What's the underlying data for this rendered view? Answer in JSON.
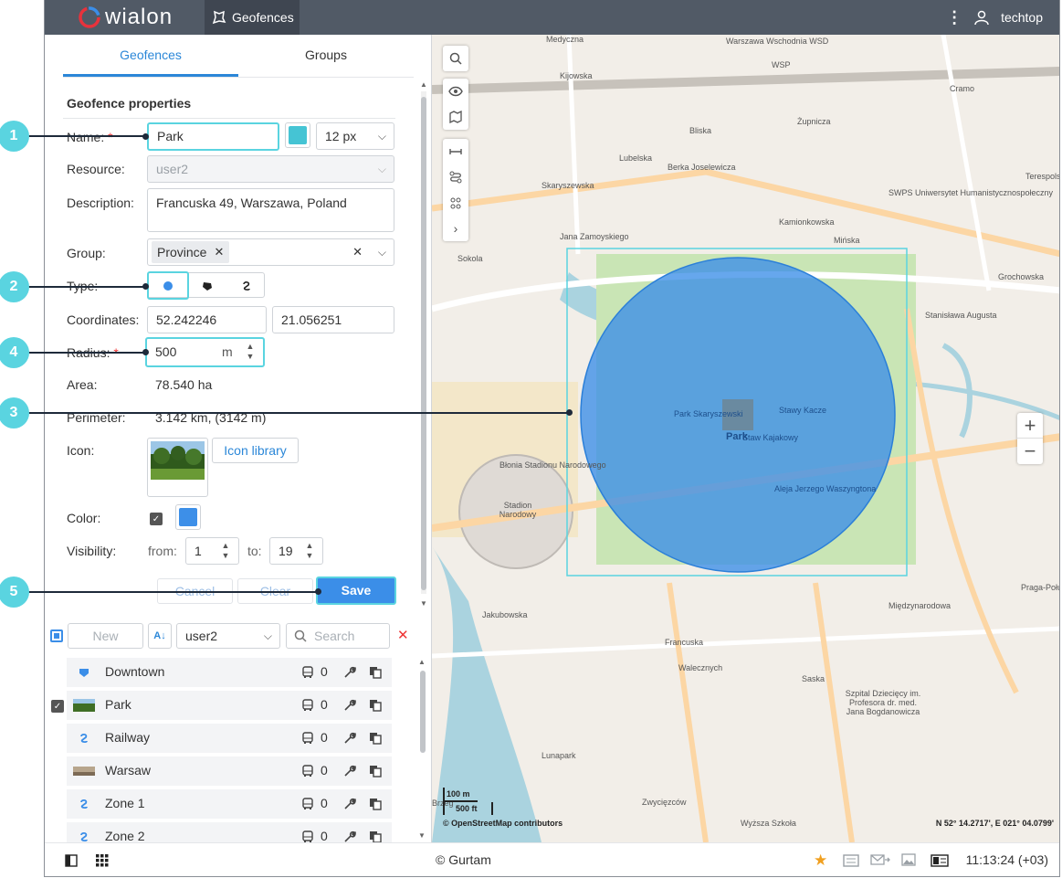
{
  "topbar": {
    "logo": "wialon",
    "app_title": "Geofences",
    "user": "techtop"
  },
  "tabs": [
    {
      "label": "Geofences",
      "active": true
    },
    {
      "label": "Groups",
      "active": false
    }
  ],
  "form": {
    "section_title": "Geofence properties",
    "name_label": "Name:",
    "required_mark": "*",
    "name_value": "Park",
    "name_color": "#45c4d4",
    "font_size": "12 px",
    "resource_label": "Resource:",
    "resource_value": "user2",
    "description_label": "Description:",
    "description_value": "Francuska 49, Warszawa, Poland",
    "group_label": "Group:",
    "group_tag": "Province",
    "type_label": "Type:",
    "coordinates_label": "Coordinates:",
    "lat": "52.242246",
    "lon": "21.056251",
    "radius_label": "Radius:",
    "radius_value": "500",
    "radius_unit": "m",
    "area_label": "Area:",
    "area_value": "78.540 ha",
    "perimeter_label": "Perimeter:",
    "perimeter_value": "3.142 km, (3142 m)",
    "icon_label": "Icon:",
    "icon_library": "Icon library",
    "color_label": "Color:",
    "fill_color": "#3d8fe8",
    "visibility_label": "Visibility:",
    "from_label": "from:",
    "from_value": "1",
    "to_label": "to:",
    "to_value": "19",
    "cancel": "Cancel",
    "clear": "Clear",
    "save": "Save"
  },
  "list_toolbar": {
    "new": "New",
    "resource": "user2",
    "search_placeholder": "Search"
  },
  "list": [
    {
      "name": "Downtown",
      "count": "0",
      "icon": "polygon-icon",
      "checked": false
    },
    {
      "name": "Park",
      "count": "0",
      "icon": "park-thumb-icon",
      "checked": true
    },
    {
      "name": "Railway",
      "count": "0",
      "icon": "line-icon",
      "checked": false
    },
    {
      "name": "Warsaw",
      "count": "0",
      "icon": "city-thumb-icon",
      "checked": false
    },
    {
      "name": "Zone 1",
      "count": "0",
      "icon": "line-icon",
      "checked": false
    },
    {
      "name": "Zone 2",
      "count": "0",
      "icon": "line-icon",
      "checked": false
    }
  ],
  "map": {
    "geofence_label": "Park",
    "attribution": "© OpenStreetMap contributors",
    "coords": "N 52° 14.2717', E 021° 04.0799'",
    "scale_m": "100 m",
    "scale_ft": "500 ft",
    "labels": [
      {
        "t": "Medyczna"
      },
      {
        "t": "Warszawa Wschodnia WSD"
      },
      {
        "t": "WSP"
      },
      {
        "t": "Kijowska"
      },
      {
        "t": "Żupnicza"
      },
      {
        "t": "Bliska"
      },
      {
        "t": "Cramo"
      },
      {
        "t": "Lubelska"
      },
      {
        "t": "Berka Joselewicza"
      },
      {
        "t": "Skaryszewska"
      },
      {
        "t": "SWPS Uniwersytet Humanistycznospołeczny"
      },
      {
        "t": "Jana Zamoyskiego"
      },
      {
        "t": "Grochowska"
      },
      {
        "t": "Terespolska"
      },
      {
        "t": "Sokola"
      },
      {
        "t": "Kamionkowska"
      },
      {
        "t": "Mińska"
      },
      {
        "t": "Stanisława Augusta"
      },
      {
        "t": "Park Skaryszewski"
      },
      {
        "t": "Stawy Kacze"
      },
      {
        "t": "Staw Kajakowy"
      },
      {
        "t": "Aleja Jerzego Waszyngtona"
      },
      {
        "t": "Błonia Stadionu Narodowego"
      },
      {
        "t": "Stadion Narodowy"
      },
      {
        "t": "Jakubowska"
      },
      {
        "t": "Francuska"
      },
      {
        "t": "Saska"
      },
      {
        "t": "Zwycięzców"
      },
      {
        "t": "Lunapark"
      },
      {
        "t": "Międzynarodowa"
      },
      {
        "t": "Szpital Dziecięcy im. Profesora dr. med. Jana Bogdanowicza"
      },
      {
        "t": "Praga-Połudn"
      },
      {
        "t": "Wyższa Szkoła"
      },
      {
        "t": "Brzeg"
      },
      {
        "t": "Walecznych"
      }
    ]
  },
  "bottombar": {
    "copyright": "© Gurtam",
    "time": "11:13:24 (+03)"
  },
  "callouts": [
    "1",
    "2",
    "3",
    "4",
    "5"
  ]
}
